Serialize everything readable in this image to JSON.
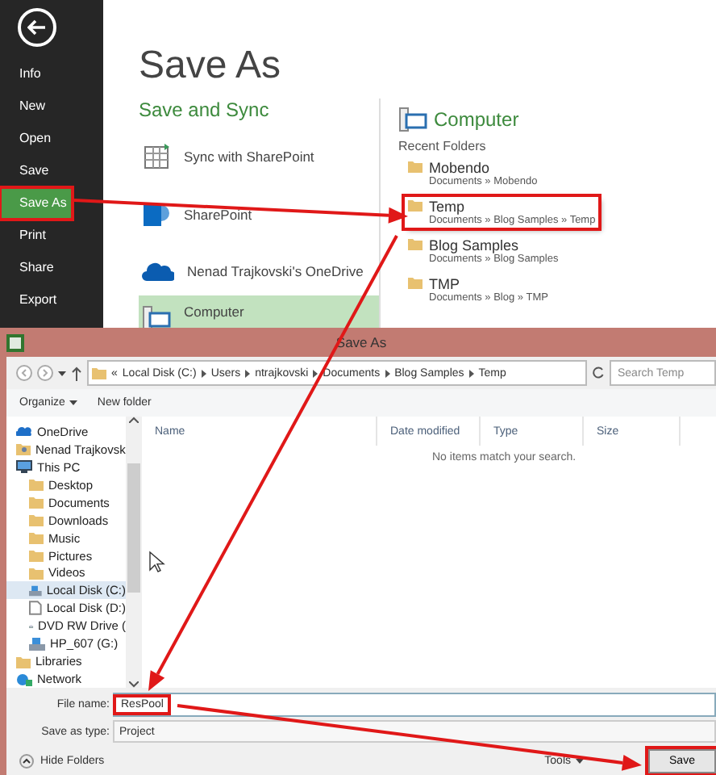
{
  "backstage": {
    "nav": [
      {
        "label": "Info",
        "selected": false,
        "highlighted": false
      },
      {
        "label": "New",
        "selected": false,
        "highlighted": false
      },
      {
        "label": "Open",
        "selected": false,
        "highlighted": false
      },
      {
        "label": "Save",
        "selected": false,
        "highlighted": false
      },
      {
        "label": "Save As",
        "selected": true,
        "highlighted": true
      },
      {
        "label": "Print",
        "selected": false,
        "highlighted": false
      },
      {
        "label": "Share",
        "selected": false,
        "highlighted": false
      },
      {
        "label": "Export",
        "selected": false,
        "highlighted": false
      }
    ],
    "title": "Save As",
    "section": "Save and Sync",
    "places": [
      {
        "label": "Sync with SharePoint",
        "kind": "sync",
        "selected": false
      },
      {
        "label": "SharePoint",
        "kind": "sharepoint",
        "selected": false
      },
      {
        "label": "Nenad Trajkovski's OneDrive",
        "kind": "onedrive",
        "selected": false
      },
      {
        "label": "Computer",
        "kind": "computer",
        "selected": true
      }
    ],
    "computer": {
      "title": "Computer",
      "recent_label": "Recent Folders",
      "folders": [
        {
          "name": "Mobendo",
          "path": "Documents » Mobendo",
          "highlighted": false
        },
        {
          "name": "Temp",
          "path": "Documents » Blog Samples » Temp",
          "highlighted": true
        },
        {
          "name": "Blog Samples",
          "path": "Documents » Blog Samples",
          "highlighted": false
        },
        {
          "name": "TMP",
          "path": "Documents » Blog » TMP",
          "highlighted": false
        }
      ]
    }
  },
  "dialog": {
    "title": "Save As",
    "breadcrumb_prefix": "«",
    "breadcrumb": [
      "Local Disk (C:)",
      "Users",
      "ntrajkovski",
      "Documents",
      "Blog Samples",
      "Temp"
    ],
    "search": {
      "placeholder": "Search Temp"
    },
    "toolbar": [
      {
        "label": "Organize",
        "kind": "menu"
      },
      {
        "label": "New folder",
        "kind": "button"
      }
    ],
    "tree": [
      {
        "label": "OneDrive",
        "kind": "cloud",
        "selected": false
      },
      {
        "label": "Nenad Trajkovsk",
        "kind": "user",
        "selected": false
      },
      {
        "label": "This PC",
        "kind": "pc",
        "selected": false,
        "children": [
          {
            "label": "Desktop",
            "kind": "folder",
            "selected": false
          },
          {
            "label": "Documents",
            "kind": "folder",
            "selected": false
          },
          {
            "label": "Downloads",
            "kind": "folder",
            "selected": false
          },
          {
            "label": "Music",
            "kind": "folder",
            "selected": false
          },
          {
            "label": "Pictures",
            "kind": "folder",
            "selected": false
          },
          {
            "label": "Videos",
            "kind": "folder",
            "selected": false
          },
          {
            "label": "Local Disk (C:)",
            "kind": "disk",
            "selected": true
          },
          {
            "label": "Local Disk (D:)",
            "kind": "file",
            "selected": false
          },
          {
            "label": "DVD RW Drive (",
            "kind": "dvd",
            "selected": false
          },
          {
            "label": "HP_607 (G:)",
            "kind": "disk",
            "selected": false
          }
        ]
      },
      {
        "label": "Libraries",
        "kind": "folder",
        "selected": false
      },
      {
        "label": "Network",
        "kind": "network",
        "selected": false
      }
    ],
    "columns": [
      "Name",
      "Date modified",
      "Type",
      "Size"
    ],
    "empty_message": "No items match your search.",
    "file_name": {
      "label": "File name:",
      "value": "ResPool",
      "highlighted": true
    },
    "save_type": {
      "label": "Save as type:",
      "value": "Project"
    },
    "hide_folders": "Hide Folders",
    "tools": "Tools",
    "save_button": {
      "label": "Save",
      "highlighted": true
    }
  }
}
